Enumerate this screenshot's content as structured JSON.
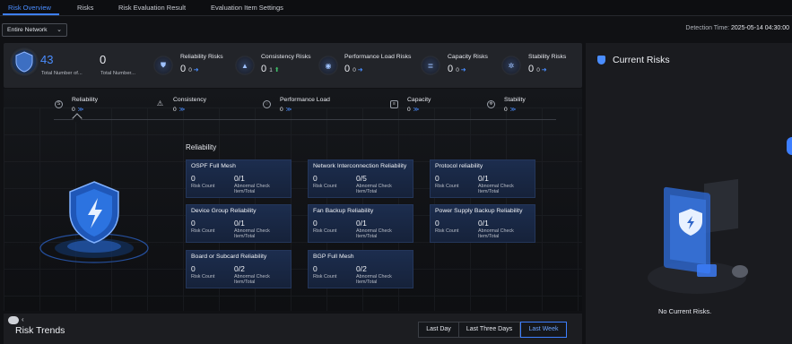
{
  "tabs": [
    {
      "label": "Risk Overview",
      "active": true
    },
    {
      "label": "Risks"
    },
    {
      "label": "Risk Evaluation Result"
    },
    {
      "label": "Evaluation Item Settings"
    }
  ],
  "filter": {
    "scope": "Entire Network"
  },
  "detection": {
    "label": "Detection Time:",
    "value": "2025-05-14 04:30:00"
  },
  "summary": {
    "total_objects": {
      "value": "43",
      "label": "Total Number of..."
    },
    "total_risks": {
      "value": "0",
      "label": "Total Number..."
    },
    "items": [
      {
        "title": "Reliability Risks",
        "value": "0",
        "delta": "0",
        "icon": "shield-icon"
      },
      {
        "title": "Consistency Risks",
        "value": "0",
        "delta": "1",
        "icon": "warning-triangle-icon"
      },
      {
        "title": "Performance Load Risks",
        "value": "0",
        "delta": "0",
        "icon": "gauge-icon"
      },
      {
        "title": "Capacity Risks",
        "value": "0",
        "delta": "0",
        "icon": "database-icon"
      },
      {
        "title": "Stability Risks",
        "value": "0",
        "delta": "0",
        "icon": "stability-icon"
      }
    ]
  },
  "categories": [
    {
      "label": "Reliability",
      "value": "0",
      "icon": "shield-icon",
      "active": true
    },
    {
      "label": "Consistency",
      "value": "0",
      "icon": "warning-triangle-icon"
    },
    {
      "label": "Performance Load",
      "value": "0",
      "icon": "gauge-icon"
    },
    {
      "label": "Capacity",
      "value": "0",
      "icon": "database-icon"
    },
    {
      "label": "Stability",
      "value": "0",
      "icon": "stability-icon"
    }
  ],
  "category_more": "≫",
  "reliability": {
    "title": "Reliability",
    "risk_count_label": "Risk Count",
    "abnormal_label": "Abnormal Check Item/Total",
    "cards": [
      {
        "title": "OSPF Full Mesh",
        "count": "0",
        "ratio": "0/1"
      },
      {
        "title": "Network Interconnection Reliability",
        "count": "0",
        "ratio": "0/5"
      },
      {
        "title": "Protocol reliability",
        "count": "0",
        "ratio": "0/1"
      },
      {
        "title": "Device Group Reliability",
        "count": "0",
        "ratio": "0/1"
      },
      {
        "title": "Fan Backup Reliability",
        "count": "0",
        "ratio": "0/1"
      },
      {
        "title": "Power Supply Backup Reliability",
        "count": "0",
        "ratio": "0/1"
      },
      {
        "title": "Board or Subcard Reliability",
        "count": "0",
        "ratio": "0/2"
      },
      {
        "title": "BGP Full Mesh",
        "count": "0",
        "ratio": "0/2"
      }
    ]
  },
  "current_risks": {
    "title": "Current Risks",
    "empty": "No Current Risks."
  },
  "trends": {
    "title": "Risk Trends",
    "ranges": [
      {
        "label": "Last Day"
      },
      {
        "label": "Last Three Days"
      },
      {
        "label": "Last Week",
        "active": true
      }
    ]
  },
  "colors": {
    "accent": "#3d7fff",
    "card": "#1c2d4e",
    "increase": "#3fbf6a"
  }
}
